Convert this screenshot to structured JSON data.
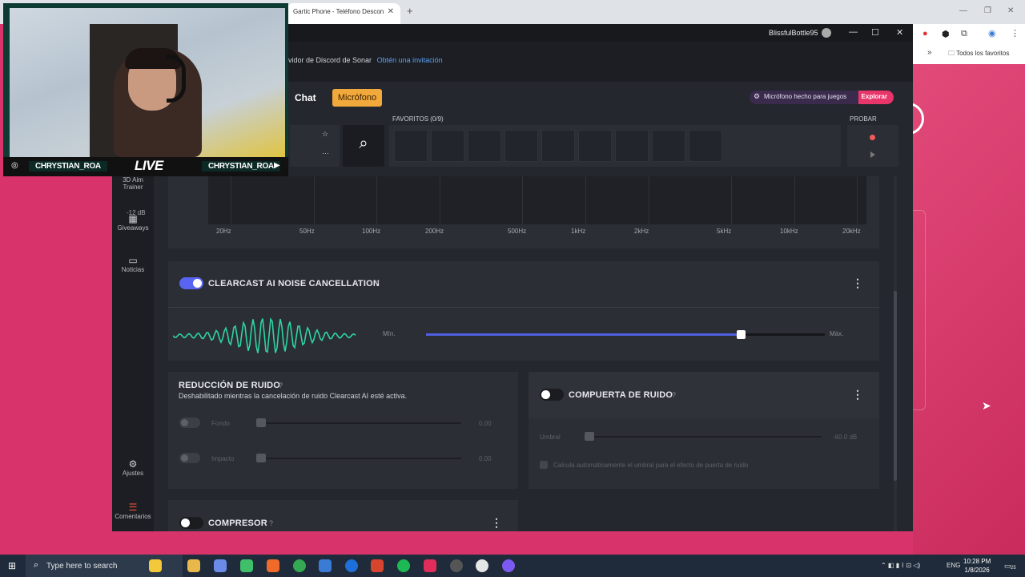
{
  "browser": {
    "tab_title": "Gartic Phone - Teléfono Descon",
    "tab_close": "✕",
    "new_tab": "+",
    "favorites_label": "Todos los favoritos",
    "minimize": "—",
    "restore": "❐",
    "close": "✕"
  },
  "app": {
    "username": "BlissfulBottle95",
    "banner_text": "ervidor de Discord de Sonar",
    "banner_link": "Obtén una invitación",
    "tabs": [
      {
        "label": "Chat"
      },
      {
        "label": "Micrófono"
      }
    ],
    "mic_pill_text": "Micrófono hecho para juegos",
    "mic_pill_link": "Explorar",
    "favorites_label": "FAVORITOS (0/9)",
    "probar_label": "PROBAR",
    "favorite_slots": 9,
    "window_controls": {
      "min": "—",
      "max": "☐",
      "close": "✕"
    }
  },
  "nav": [
    {
      "label": "3D Aim Trainer",
      "icon": "target-icon"
    },
    {
      "label": "Giveaways",
      "icon": "gift-icon"
    },
    {
      "label": "Noticias",
      "icon": "news-icon"
    },
    {
      "label": "Ajustes",
      "icon": "gear-icon"
    },
    {
      "label": "Comentarios",
      "icon": "feedback-icon"
    }
  ],
  "eq": {
    "db_label": "-12 dB",
    "freq_ticks": [
      "20Hz",
      "50Hz",
      "100Hz",
      "200Hz",
      "500Hz",
      "1kHz",
      "2kHz",
      "5kHz",
      "10kHz",
      "20kHz"
    ]
  },
  "clearcast": {
    "title": "CLEARCAST AI NOISE CANCELLATION",
    "help": "?",
    "enabled": true,
    "min_label": "Mín.",
    "max_label": "Máx.",
    "level": 0.79
  },
  "noise_reduction": {
    "title": "REDUCCIÓN DE RUIDO",
    "help": "?",
    "subtitle": "Deshabilitado mientras la cancelación de ruido Clearcast AI esté activa.",
    "rows": [
      {
        "label": "Fondo",
        "value": "0.00"
      },
      {
        "label": "Impacto",
        "value": "0.00"
      }
    ]
  },
  "noise_gate": {
    "title": "COMPUERTA DE RUIDO",
    "help": "?",
    "enabled": false,
    "threshold_label": "Umbral",
    "threshold_value": "-60.0 dB",
    "auto_label": "Calcula automáticamente el umbral para el efecto de puerta de ruido"
  },
  "compressor": {
    "title": "COMPRESOR",
    "help": "?",
    "enabled": false
  },
  "webcam": {
    "name_left": "CHRYSTIAN_ROA",
    "live": "LIVE",
    "name_right": "CHRYSTIAN_ROA"
  },
  "taskbar": {
    "search_placeholder": "Type here to search",
    "lang": "ENG",
    "time": "10:28 PM",
    "date": "1/8/2026",
    "notif_count": "25"
  },
  "colors": {
    "accent": "#4f5fe0",
    "mic_tab": "#f2a93b",
    "explore": "#e8356a",
    "wave": "#2fd4a2"
  }
}
